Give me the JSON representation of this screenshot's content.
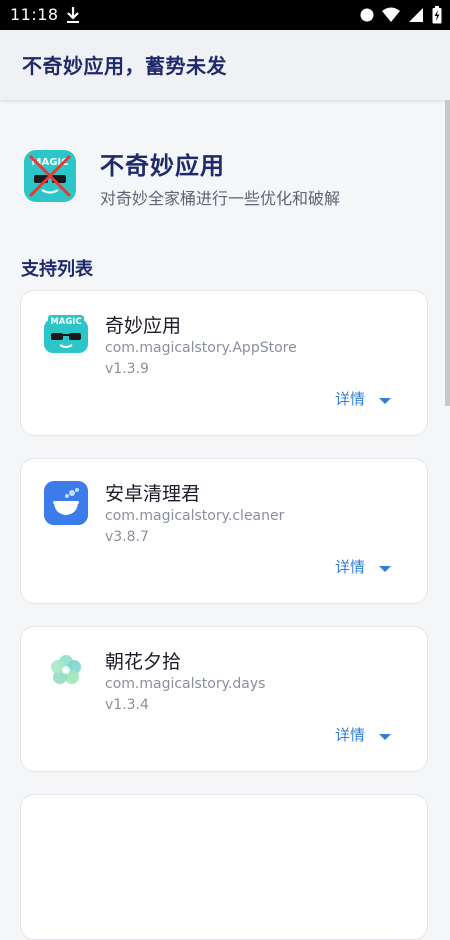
{
  "status_bar": {
    "time": "11:18"
  },
  "app_bar": {
    "title": "不奇妙应用，蓄势未发"
  },
  "hero": {
    "title": "不奇妙应用",
    "subtitle": "对奇妙全家桶进行一些优化和破解",
    "logo_text": "MAGIC"
  },
  "section": {
    "title": "支持列表"
  },
  "apps": [
    {
      "name": "奇妙应用",
      "package": "com.magicalstory.AppStore",
      "version": "v1.3.9",
      "details_label": "详情",
      "icon": "magic-glasses-icon",
      "icon_text": "MAGIC"
    },
    {
      "name": "安卓清理君",
      "package": "com.magicalstory.cleaner",
      "version": "v3.8.7",
      "details_label": "详情",
      "icon": "cleaner-brush-icon"
    },
    {
      "name": "朝花夕拾",
      "package": "com.magicalstory.days",
      "version": "v1.3.4",
      "details_label": "详情",
      "icon": "flower-icon"
    }
  ],
  "colors": {
    "accent": "#2f7fd6",
    "title": "#1f2a6b",
    "magic_teal": "#2cc6c9",
    "cleaner_blue": "#3b7bea"
  }
}
